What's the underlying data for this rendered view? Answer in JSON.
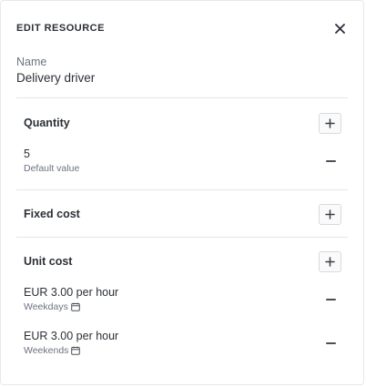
{
  "header": {
    "title": "EDIT RESOURCE",
    "close_icon": "close-icon"
  },
  "name": {
    "label": "Name",
    "value": "Delivery driver"
  },
  "quantity": {
    "title": "Quantity",
    "value": "5",
    "sub": "Default value"
  },
  "fixed_cost": {
    "title": "Fixed cost"
  },
  "unit_cost": {
    "title": "Unit cost",
    "items": [
      {
        "value": "EUR 3.00 per hour",
        "sub": "Weekdays",
        "icon": "calendar-icon"
      },
      {
        "value": "EUR 3.00 per hour",
        "sub": "Weekends",
        "icon": "calendar-icon"
      }
    ]
  },
  "colors": {
    "text": "#2b2f36",
    "muted": "#6b7280",
    "divider": "#e3e5e8"
  }
}
